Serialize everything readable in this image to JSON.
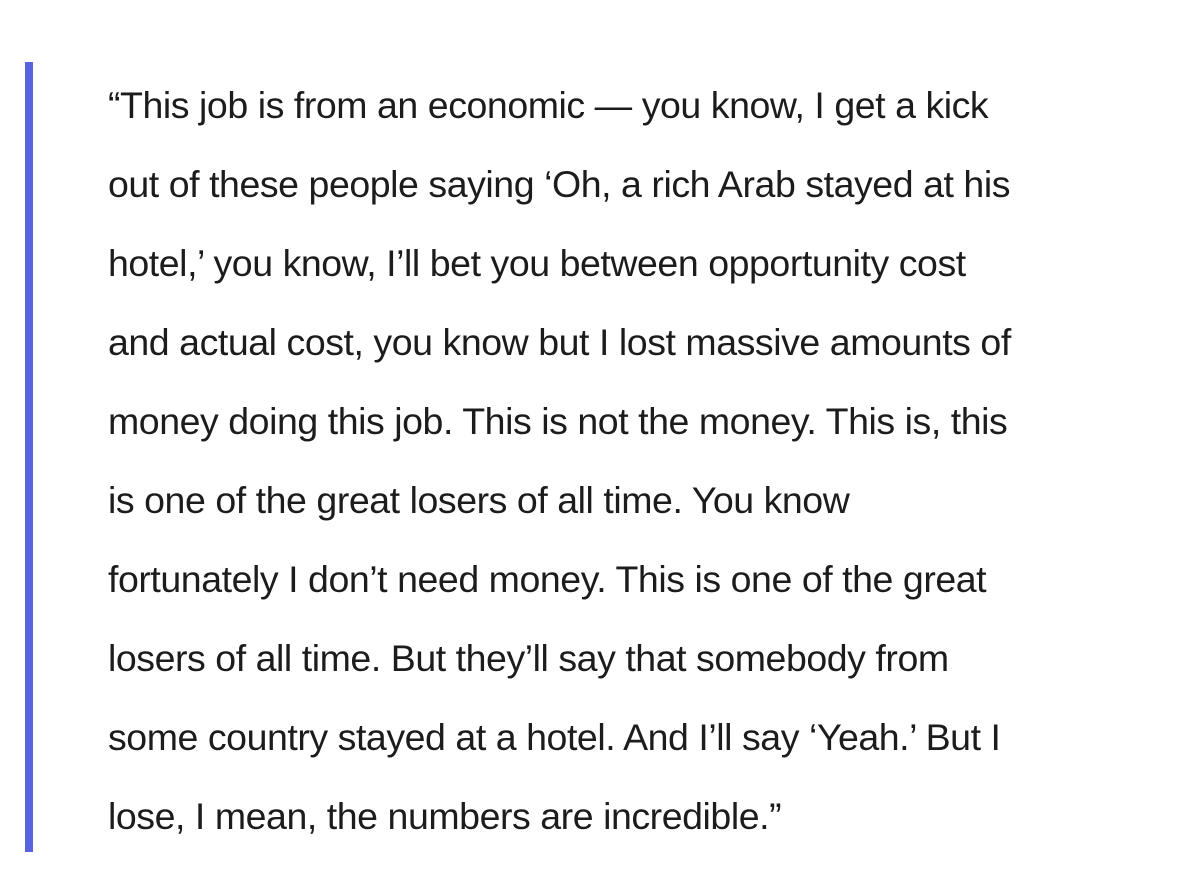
{
  "quote": {
    "lines": [
      "“This job is from an economic — you know, I get a kick",
      "out of these people saying ‘Oh, a rich Arab stayed at his",
      "hotel,’ you know, I’ll bet you between opportunity cost",
      "and actual cost, you know but I lost massive amounts of",
      "money doing this job. This is not the money. This is, this",
      "is one of the great losers of all time. You know",
      "fortunately I don’t need money. This is one of the great",
      "losers of all time. But they’ll say that somebody from",
      "some country stayed at a hotel. And I’ll say ‘Yeah.’ But I",
      "lose, I mean, the numbers are incredible.”"
    ]
  },
  "colors": {
    "accent_bar": "#5a63de",
    "text": "#1c1c1c",
    "background": "#ffffff"
  }
}
